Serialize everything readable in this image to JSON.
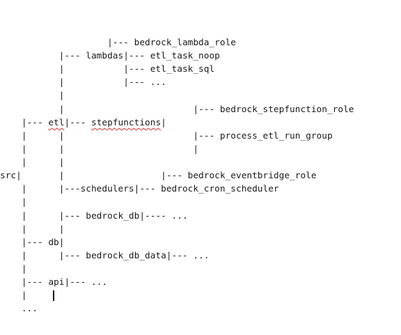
{
  "document": {
    "lines": [
      [
        "                    |--- bedrock_lambda_role"
      ],
      [
        "           |--- lambdas|--- etl_task_noop"
      ],
      [
        "           |           |--- etl_task_sql"
      ],
      [
        "           |           |--- ..."
      ],
      [
        "           |"
      ],
      [
        "           |                        |--- bedrock_stepfunction_role"
      ],
      [
        "    |--- ",
        "etl",
        "|--- ",
        "stepfunctions",
        "|"
      ],
      [
        "    |      |                        |--- process_etl_run_group"
      ],
      [
        "    |      |                        |"
      ],
      [
        "    |      |"
      ],
      [
        "src|       |                  |--- bedrock_eventbridge_role"
      ],
      [
        "    |      |---schedulers|--- bedrock_cron_scheduler"
      ],
      [
        "    |"
      ],
      [
        "    |      |--- bedrock_db|---- ..."
      ],
      [
        "    |      |"
      ],
      [
        "    |--- db|"
      ],
      [
        "    |      |--- bedrock_db_data|--- ..."
      ],
      [
        "    |"
      ],
      [
        "    |--- api|--- ..."
      ],
      [
        "    |"
      ],
      [
        "    ..."
      ]
    ],
    "spellcheck_flagged": [
      "etl",
      "stepfunctions"
    ],
    "squiggle_color": "#d93025",
    "text_color": "#1a1a1a"
  }
}
